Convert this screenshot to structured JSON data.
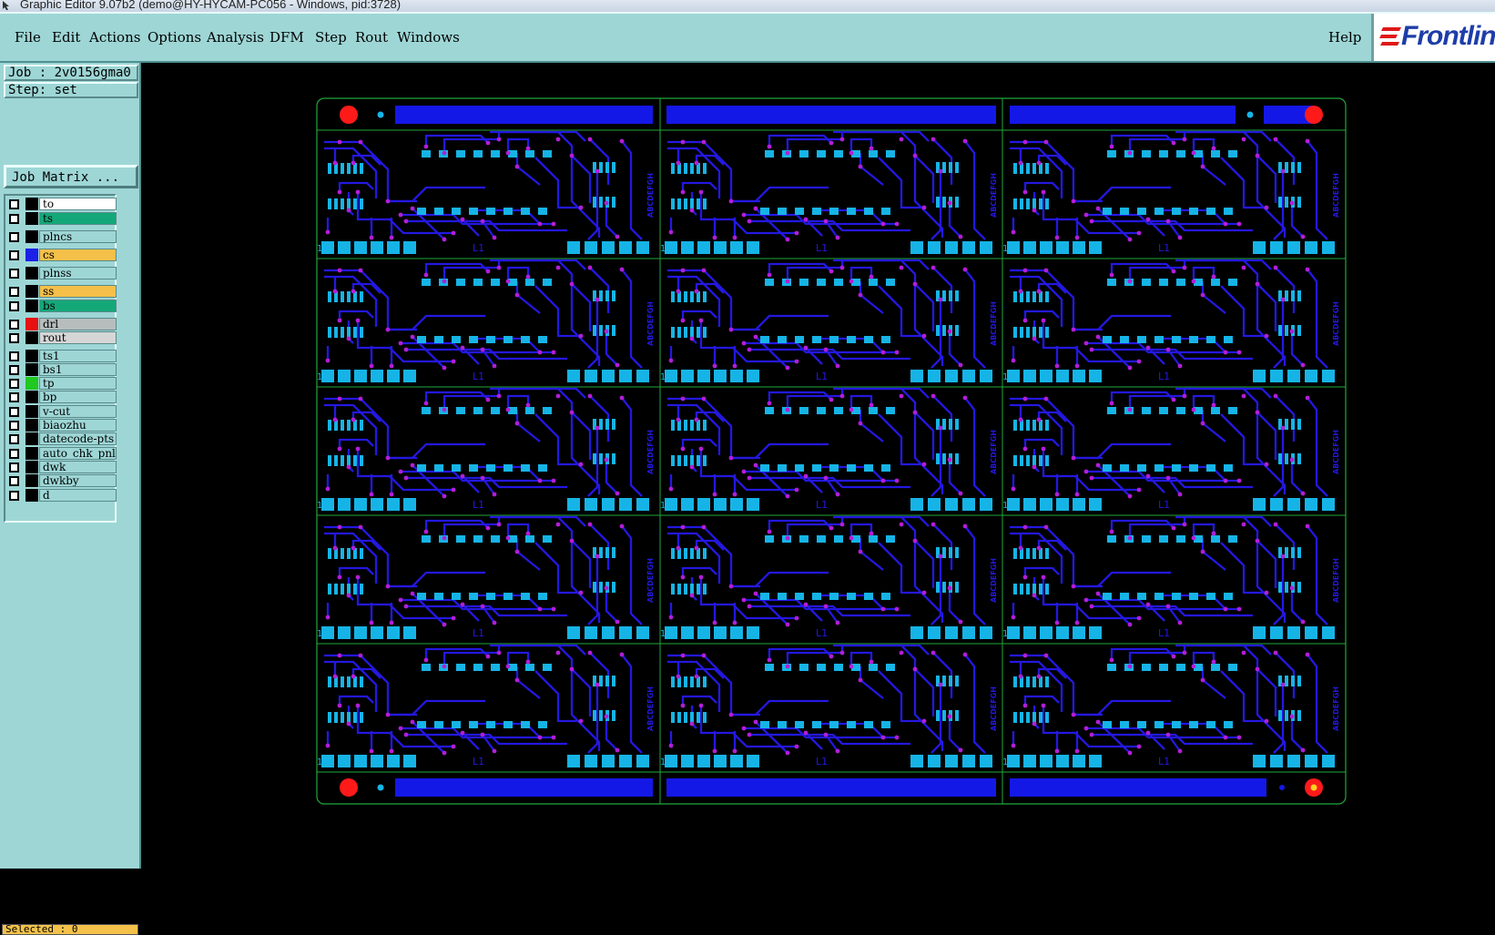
{
  "window": {
    "title": "Graphic Editor 9.07b2 (demo@HY-HYCAM-PC056 - Windows, pid:3728)"
  },
  "menubar": {
    "items": [
      "File",
      "Edit",
      "Actions",
      "Options",
      "Analysis",
      "DFM",
      "Step",
      "Rout",
      "Windows"
    ],
    "help": "Help"
  },
  "logo": {
    "text": "Frontline"
  },
  "panel": {
    "job": "Job : 2v0156gma0",
    "step": "Step: set",
    "job_matrix_button": "Job Matrix ...",
    "selected": "Selected : 0"
  },
  "layers": [
    {
      "name": "to",
      "color": "#000000",
      "bg": "#ffffff"
    },
    {
      "name": "ts",
      "color": "#000000",
      "bg": "#14a879"
    },
    {
      "name": "plncs",
      "color": "#000000",
      "bg": "#9ed6d6"
    },
    {
      "name": "cs",
      "color": "#1a20e6",
      "bg": "#f5c04a"
    },
    {
      "name": "plnss",
      "color": "#000000",
      "bg": "#9ed6d6"
    },
    {
      "name": "ss",
      "color": "#000000",
      "bg": "#f5c04a"
    },
    {
      "name": "bs",
      "color": "#000000",
      "bg": "#14a879"
    },
    {
      "name": "drl",
      "color": "#e81010",
      "bg": "#b7bdbd"
    },
    {
      "name": "rout",
      "color": "#000000",
      "bg": "#d6d6d6"
    },
    {
      "name": "ts1",
      "color": "#000000",
      "bg": "#9ed6d6"
    },
    {
      "name": "bs1",
      "color": "#000000",
      "bg": "#9ed6d6"
    },
    {
      "name": "tp",
      "color": "#20c820",
      "bg": "#9ed6d6"
    },
    {
      "name": "bp",
      "color": "#000000",
      "bg": "#9ed6d6"
    },
    {
      "name": "v-cut",
      "color": "#000000",
      "bg": "#9ed6d6"
    },
    {
      "name": "biaozhu",
      "color": "#000000",
      "bg": "#9ed6d6"
    },
    {
      "name": "datecode-pts",
      "color": "#000000",
      "bg": "#9ed6d6"
    },
    {
      "name": "auto_chk_pnl",
      "color": "#000000",
      "bg": "#9ed6d6"
    },
    {
      "name": "dwk",
      "color": "#000000",
      "bg": "#9ed6d6"
    },
    {
      "name": "dwkby",
      "color": "#000000",
      "bg": "#9ed6d6"
    },
    {
      "name": "d",
      "color": "#000000",
      "bg": "#9ed6d6"
    }
  ],
  "board": {
    "columns": 3,
    "rows": 5,
    "unit_label": "L1",
    "side_text": "ABCDEFGH",
    "pin_mark": "1",
    "colors": {
      "outline": "#1fa83c",
      "trace": "#2418e0",
      "pad": "#16b4e6",
      "via": "#b31ed8",
      "fiducial": "#ff1a1a",
      "fiducial_dot": "#ffd21e",
      "rail_bar": "#1418e6"
    }
  }
}
